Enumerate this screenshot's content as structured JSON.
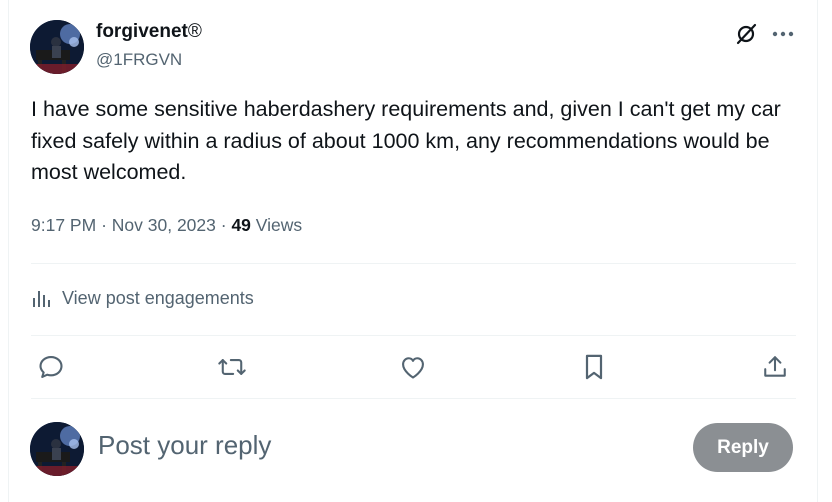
{
  "author": {
    "display_name": "forgivenet",
    "badge_glyph": "®",
    "handle": "@1FRGVN"
  },
  "post": {
    "text": "I have some sensitive haberdashery requirements and, given I can't get my car fixed safely within a radius of about 1000 km, any recommendations would be most welcomed.",
    "time": "9:17 PM",
    "separator": "·",
    "date": "Nov 30, 2023",
    "views_count": "49",
    "views_label": "Views"
  },
  "engagements_link": "View post engagements",
  "actions": {
    "reply_icon": "speech-bubble-icon",
    "repost_icon": "repost-arrows-icon",
    "like_icon": "heart-icon",
    "bookmark_icon": "bookmark-icon",
    "share_icon": "share-upload-icon"
  },
  "reply_box": {
    "placeholder": "Post your reply",
    "button_label": "Reply"
  },
  "colors": {
    "text_primary": "#0f1419",
    "text_secondary": "#536471",
    "divider": "#eff3f4",
    "reply_button_disabled": "#8b8f93"
  }
}
